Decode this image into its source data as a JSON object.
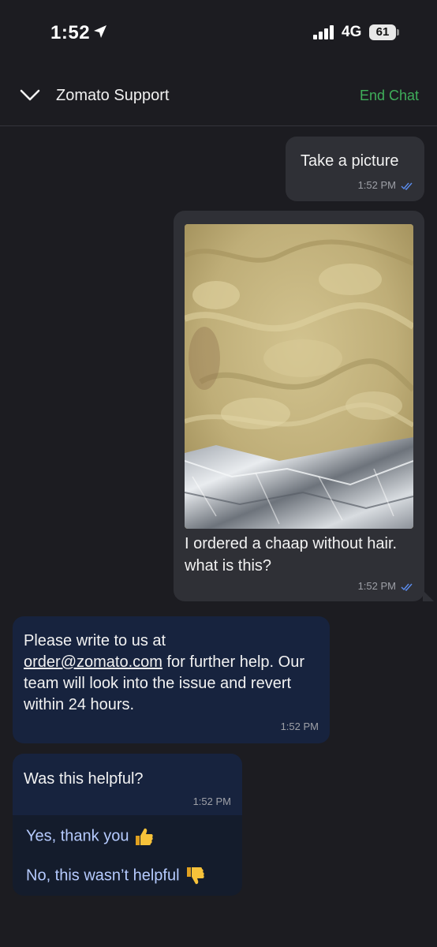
{
  "status_bar": {
    "time": "1:52",
    "network": "4G",
    "battery": "61"
  },
  "header": {
    "title": "Zomato Support",
    "end_chat_label": "End Chat"
  },
  "messages": [
    {
      "direction": "outgoing",
      "text": "Take a picture",
      "time": "1:52 PM"
    },
    {
      "direction": "outgoing",
      "type": "image",
      "caption": "I ordered a chaap without hair. what is this?",
      "time": "1:52 PM"
    },
    {
      "direction": "incoming",
      "text_before_link": "Please write to us at",
      "link": "order@zomato.com",
      "text_after_link": "for further help. Our team will look into the issue and revert within 24 hours.",
      "time": "1:52 PM"
    },
    {
      "direction": "incoming",
      "text": "Was this helpful?",
      "time": "1:52 PM",
      "options": [
        "Yes, thank you",
        "No, this wasn’t helpful"
      ]
    }
  ],
  "icons": {
    "location": "location-arrow-icon",
    "signal": "signal-bars-icon",
    "back": "chevron-down-icon",
    "read": "double-check-icon",
    "yes": "thumbs-up-emoji",
    "no": "thumbs-down-emoji"
  },
  "colors": {
    "background": "#1c1c21",
    "outgoing_bubble": "#2f3036",
    "incoming_bubble": "#17233e",
    "end_chat": "#3fae5a",
    "option_text": "#b6cbff",
    "read_ticks": "#5b8def"
  }
}
